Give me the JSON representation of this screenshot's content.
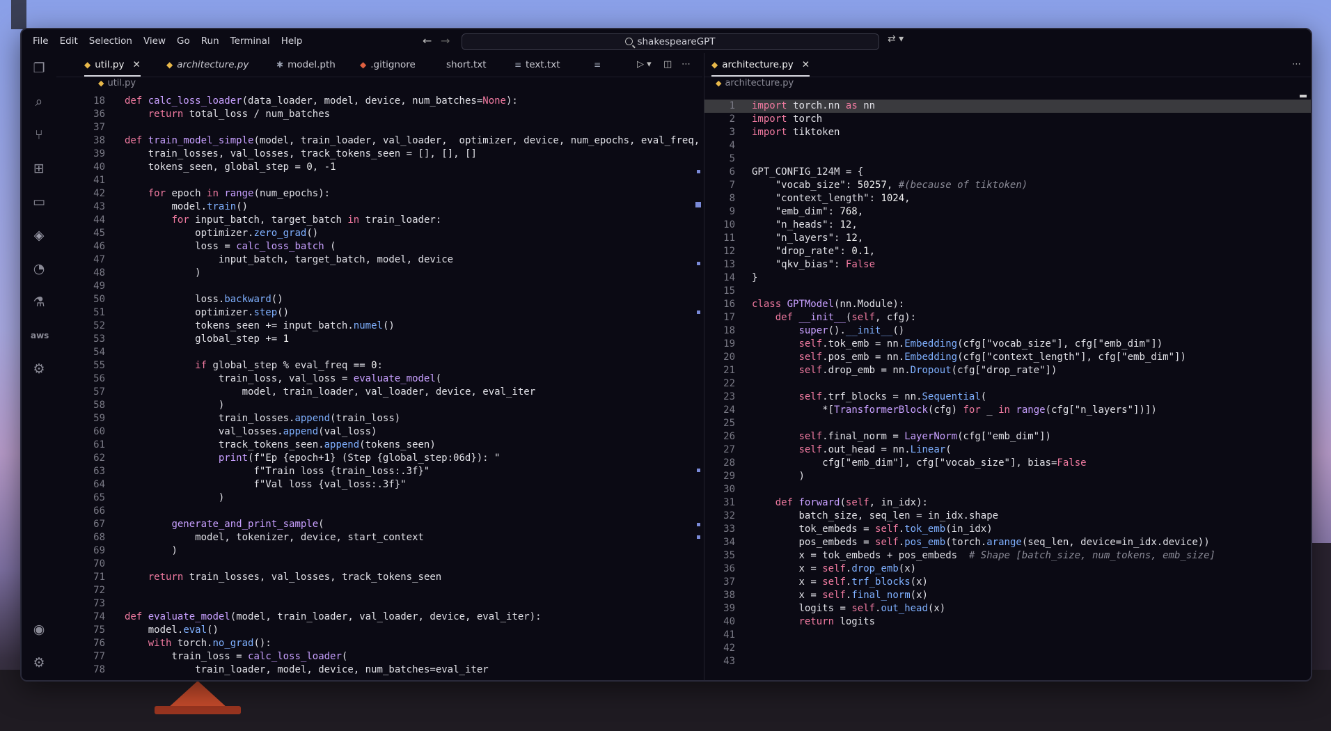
{
  "menu": [
    "File",
    "Edit",
    "Selection",
    "View",
    "Go",
    "Run",
    "Terminal",
    "Help"
  ],
  "search_label": "shakespeareGPT",
  "left_tabs": [
    {
      "label": "util.py",
      "icon": "python-icon",
      "active": true,
      "italic": false,
      "close": "✕"
    },
    {
      "label": "architecture.py",
      "icon": "python-icon",
      "active": false,
      "italic": true
    },
    {
      "label": "model.pth",
      "icon": "asterisk-icon",
      "active": false,
      "italic": false
    },
    {
      "label": ".gitignore",
      "icon": "git-icon",
      "active": false,
      "italic": false
    },
    {
      "label": "short.txt",
      "icon": "text-file-icon",
      "active": false,
      "italic": false
    },
    {
      "label": "text.txt",
      "icon": "text-file-icon",
      "active": false,
      "italic": false
    }
  ],
  "right_tabs": [
    {
      "label": "architecture.py",
      "icon": "python-icon",
      "active": true,
      "close": "✕"
    }
  ],
  "left_breadcrumb": "util.py",
  "right_breadcrumb": "architecture.py",
  "left_code": [
    {
      "n": "18",
      "t": "def calc_loss_loader(data_loader, model, device, num_batches=None):"
    },
    {
      "n": "36",
      "t": "    return total_loss / num_batches"
    },
    {
      "n": "37",
      "t": ""
    },
    {
      "n": "38",
      "t": "def train_model_simple(model, train_loader, val_loader,  optimizer, device, num_epochs, eval_freq,"
    },
    {
      "n": "39",
      "t": "    train_losses, val_losses, track_tokens_seen = [], [], []"
    },
    {
      "n": "40",
      "t": "    tokens_seen, global_step = 0, -1"
    },
    {
      "n": "41",
      "t": ""
    },
    {
      "n": "42",
      "t": "    for epoch in range(num_epochs):"
    },
    {
      "n": "43",
      "t": "        model.train()"
    },
    {
      "n": "44",
      "t": "        for input_batch, target_batch in train_loader:"
    },
    {
      "n": "45",
      "t": "            optimizer.zero_grad()"
    },
    {
      "n": "46",
      "t": "            loss = calc_loss_batch ("
    },
    {
      "n": "47",
      "t": "                input_batch, target_batch, model, device"
    },
    {
      "n": "48",
      "t": "            )"
    },
    {
      "n": "49",
      "t": ""
    },
    {
      "n": "50",
      "t": "            loss.backward()"
    },
    {
      "n": "51",
      "t": "            optimizer.step()"
    },
    {
      "n": "52",
      "t": "            tokens_seen += input_batch.numel()"
    },
    {
      "n": "53",
      "t": "            global_step += 1"
    },
    {
      "n": "54",
      "t": ""
    },
    {
      "n": "55",
      "t": "            if global_step % eval_freq == 0:"
    },
    {
      "n": "56",
      "t": "                train_loss, val_loss = evaluate_model("
    },
    {
      "n": "57",
      "t": "                    model, train_loader, val_loader, device, eval_iter"
    },
    {
      "n": "58",
      "t": "                )"
    },
    {
      "n": "59",
      "t": "                train_losses.append(train_loss)"
    },
    {
      "n": "60",
      "t": "                val_losses.append(val_loss)"
    },
    {
      "n": "61",
      "t": "                track_tokens_seen.append(tokens_seen)"
    },
    {
      "n": "62",
      "t": "                print(f\"Ep {epoch+1} (Step {global_step:06d}): \""
    },
    {
      "n": "63",
      "t": "                      f\"Train loss {train_loss:.3f}\""
    },
    {
      "n": "64",
      "t": "                      f\"Val loss {val_loss:.3f}\""
    },
    {
      "n": "65",
      "t": "                )"
    },
    {
      "n": "66",
      "t": ""
    },
    {
      "n": "67",
      "t": "        generate_and_print_sample("
    },
    {
      "n": "68",
      "t": "            model, tokenizer, device, start_context"
    },
    {
      "n": "69",
      "t": "        )"
    },
    {
      "n": "70",
      "t": ""
    },
    {
      "n": "71",
      "t": "    return train_losses, val_losses, track_tokens_seen"
    },
    {
      "n": "72",
      "t": ""
    },
    {
      "n": "73",
      "t": ""
    },
    {
      "n": "74",
      "t": "def evaluate_model(model, train_loader, val_loader, device, eval_iter):"
    },
    {
      "n": "75",
      "t": "    model.eval()"
    },
    {
      "n": "76",
      "t": "    with torch.no_grad():"
    },
    {
      "n": "77",
      "t": "        train_loss = calc_loss_loader("
    },
    {
      "n": "78",
      "t": "            train_loader, model, device, num_batches=eval_iter"
    }
  ],
  "right_code": [
    {
      "n": "1",
      "t": "import torch.nn as nn"
    },
    {
      "n": "2",
      "t": "import torch"
    },
    {
      "n": "3",
      "t": "import tiktoken"
    },
    {
      "n": "4",
      "t": ""
    },
    {
      "n": "5",
      "t": ""
    },
    {
      "n": "6",
      "t": "GPT_CONFIG_124M = {"
    },
    {
      "n": "7",
      "t": "    \"vocab_size\": 50257, #(because of tiktoken)"
    },
    {
      "n": "8",
      "t": "    \"context_length\": 1024,"
    },
    {
      "n": "9",
      "t": "    \"emb_dim\": 768,"
    },
    {
      "n": "10",
      "t": "    \"n_heads\": 12,"
    },
    {
      "n": "11",
      "t": "    \"n_layers\": 12,"
    },
    {
      "n": "12",
      "t": "    \"drop_rate\": 0.1,"
    },
    {
      "n": "13",
      "t": "    \"qkv_bias\": False"
    },
    {
      "n": "14",
      "t": "}"
    },
    {
      "n": "15",
      "t": ""
    },
    {
      "n": "16",
      "t": "class GPTModel(nn.Module):"
    },
    {
      "n": "17",
      "t": "    def __init__(self, cfg):"
    },
    {
      "n": "18",
      "t": "        super().__init__()"
    },
    {
      "n": "19",
      "t": "        self.tok_emb = nn.Embedding(cfg[\"vocab_size\"], cfg[\"emb_dim\"])"
    },
    {
      "n": "20",
      "t": "        self.pos_emb = nn.Embedding(cfg[\"context_length\"], cfg[\"emb_dim\"])"
    },
    {
      "n": "21",
      "t": "        self.drop_emb = nn.Dropout(cfg[\"drop_rate\"])"
    },
    {
      "n": "22",
      "t": ""
    },
    {
      "n": "23",
      "t": "        self.trf_blocks = nn.Sequential("
    },
    {
      "n": "24",
      "t": "            *[TransformerBlock(cfg) for _ in range(cfg[\"n_layers\"])])"
    },
    {
      "n": "25",
      "t": ""
    },
    {
      "n": "26",
      "t": "        self.final_norm = LayerNorm(cfg[\"emb_dim\"])"
    },
    {
      "n": "27",
      "t": "        self.out_head = nn.Linear("
    },
    {
      "n": "28",
      "t": "            cfg[\"emb_dim\"], cfg[\"vocab_size\"], bias=False"
    },
    {
      "n": "29",
      "t": "        )"
    },
    {
      "n": "30",
      "t": ""
    },
    {
      "n": "31",
      "t": "    def forward(self, in_idx):"
    },
    {
      "n": "32",
      "t": "        batch_size, seq_len = in_idx.shape"
    },
    {
      "n": "33",
      "t": "        tok_embeds = self.tok_emb(in_idx)"
    },
    {
      "n": "34",
      "t": "        pos_embeds = self.pos_emb(torch.arange(seq_len, device=in_idx.device))"
    },
    {
      "n": "35",
      "t": "        x = tok_embeds + pos_embeds  # Shape [batch_size, num_tokens, emb_size]"
    },
    {
      "n": "36",
      "t": "        x = self.drop_emb(x)"
    },
    {
      "n": "37",
      "t": "        x = self.trf_blocks(x)"
    },
    {
      "n": "38",
      "t": "        x = self.final_norm(x)"
    },
    {
      "n": "39",
      "t": "        logits = self.out_head(x)"
    },
    {
      "n": "40",
      "t": "        return logits"
    },
    {
      "n": "41",
      "t": ""
    },
    {
      "n": "42",
      "t": ""
    },
    {
      "n": "43",
      "t": ""
    }
  ],
  "activity_icons": [
    "files-icon",
    "search-icon",
    "source-control-icon",
    "extensions-icon",
    "remote-explorer-icon",
    "python-icon",
    "git-graph-icon",
    "testing-icon",
    "aws-icon",
    "deploy-icon",
    "account-icon",
    "settings-icon"
  ],
  "aws_label": "aws",
  "colors": {
    "background": "#0b0a14",
    "keyword": "#f07aa0",
    "function": "#c8a0ff",
    "comment": "#8a8a96"
  }
}
